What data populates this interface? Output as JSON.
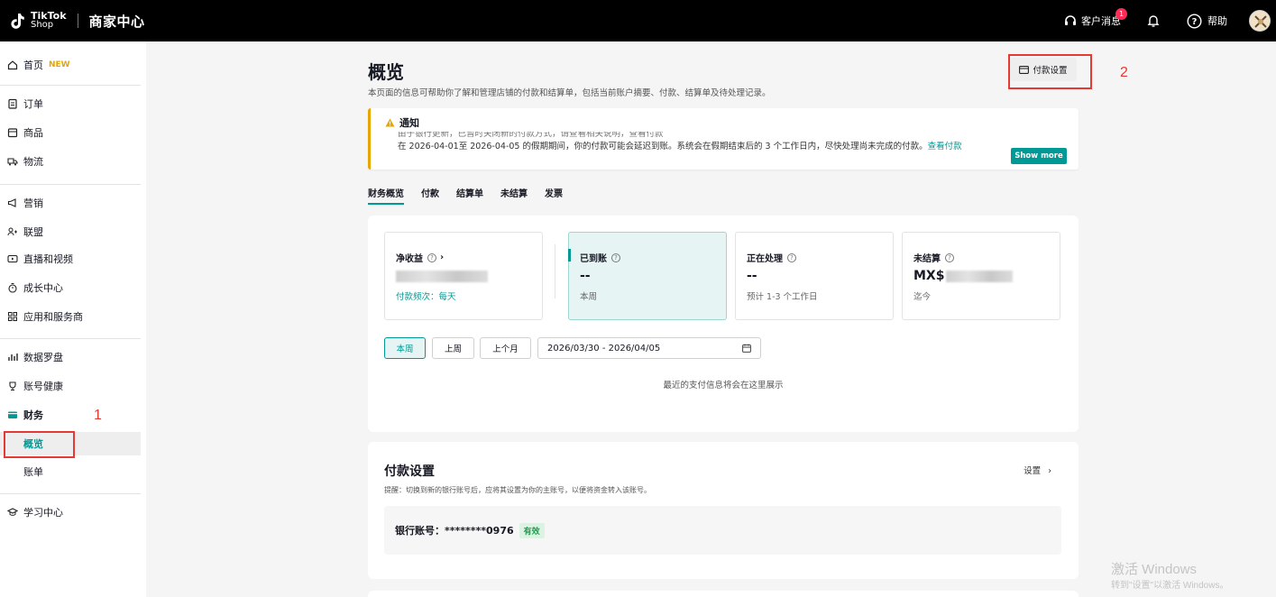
{
  "topbar": {
    "logo_line1": "TikTok",
    "logo_line2": "Shop",
    "app_title": "商家中心",
    "messages_label": "客户消息",
    "messages_badge": "1",
    "help_label": "帮助"
  },
  "sidebar": {
    "home": "首页",
    "new_tag": "NEW",
    "orders": "订单",
    "products": "商品",
    "logistics": "物流",
    "marketing": "营销",
    "affiliate": "联盟",
    "live_video": "直播和视频",
    "growth": "成长中心",
    "apps": "应用和服务商",
    "data_compass": "数据罗盘",
    "account_health": "账号健康",
    "finance": "财务",
    "overview": "概览",
    "bills": "账单",
    "learning": "学习中心"
  },
  "page": {
    "title": "概览",
    "description": "本页面的信息可帮助你了解和管理店铺的付款和结算单，包括当前账户摘要、付款、结算单及待处理记录。",
    "payment_settings_button": "付款设置"
  },
  "notice": {
    "title": "通知",
    "line1": "由于银行更新，已暂时关闭新的付款方式，请查看相关说明，查看付款",
    "line2": "在 2026-04-01至 2026-04-05 的假期期间，你的付款可能会延迟到账。系统会在假期结束后的 3 个工作日内，尽快处理尚未完成的付款。",
    "line2_link": "查看付款",
    "show_more": "Show more"
  },
  "tabs": [
    "财务概览",
    "付款",
    "结算单",
    "未结算",
    "发票"
  ],
  "stats": {
    "net_income_label": "净收益",
    "net_income_link": "付款频次：每天",
    "received_label": "已到账",
    "received_value": "--",
    "received_sub": "本周",
    "processing_label": "正在处理",
    "processing_value": "--",
    "processing_sub": "预计 1-3 个工作日",
    "unsettled_label": "未结算",
    "unsettled_prefix": "MX$",
    "unsettled_sub": "迄今"
  },
  "range": {
    "this_week": "本周",
    "last_week": "上周",
    "last_month": "上个月",
    "date_range": "2026/03/30 - 2026/04/05",
    "empty": "最近的支付信息将会在这里展示"
  },
  "payment_settings": {
    "title": "付款设置",
    "hint": "提醒：切换到新的银行账号后，应将其设置为你的主账号，以便将资金转入该账号。",
    "settings_link": "设置",
    "bank_label": "银行账号：********0976",
    "status": "有效"
  },
  "annotations": {
    "a1": "1",
    "a2": "2"
  },
  "watermark": {
    "line1": "激活 Windows",
    "line2": "转到\"设置\"以激活 Windows。"
  },
  "colors": {
    "accent": "#009995",
    "warning": "#e5a600",
    "annotation": "#e53935"
  }
}
